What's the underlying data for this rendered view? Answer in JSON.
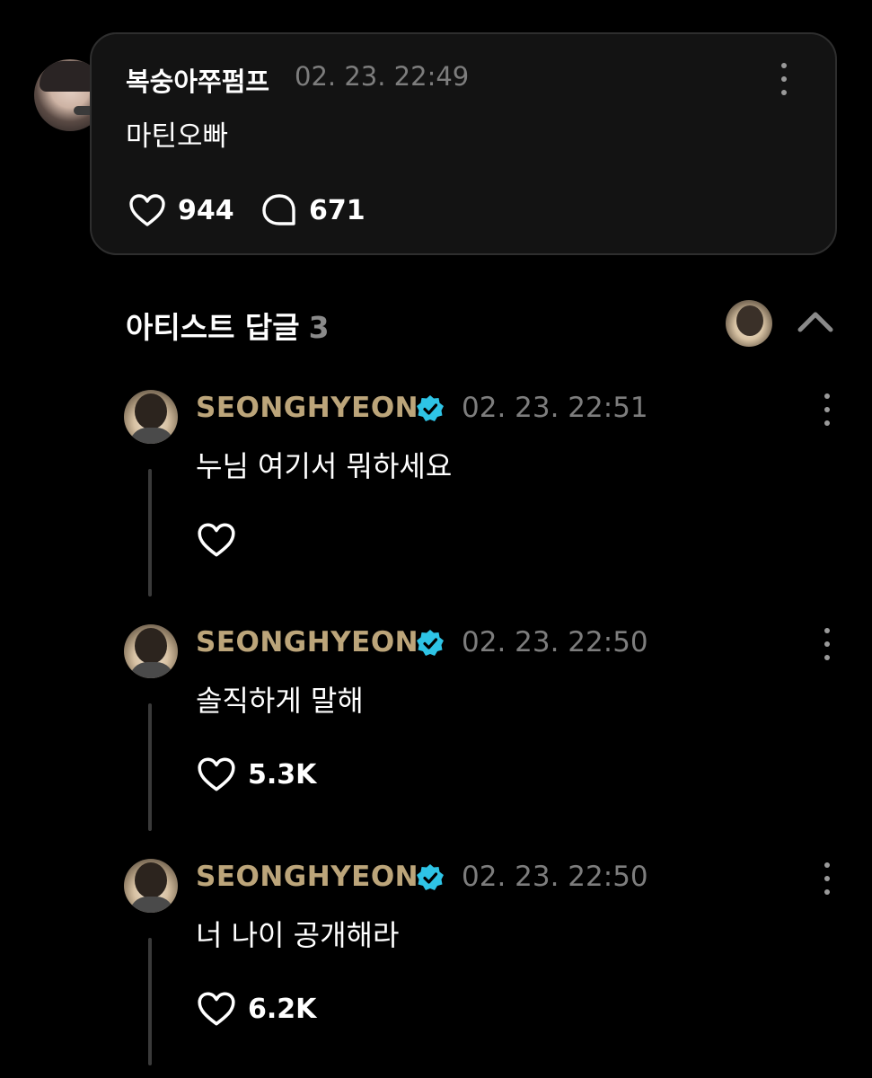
{
  "post": {
    "author": "복숭아쭈펌프",
    "timestamp": "02. 23. 22:49",
    "text": "마틴오빠",
    "likes": "944",
    "comments": "671"
  },
  "artist_replies": {
    "title": "아티스트 답글",
    "count": "3"
  },
  "replies": [
    {
      "author": "SEONGHYEON",
      "timestamp": "02. 23. 22:51",
      "text": "누님 여기서 뭐하세요",
      "likes": ""
    },
    {
      "author": "SEONGHYEON",
      "timestamp": "02. 23. 22:50",
      "text": "솔직하게 말해",
      "likes": "5.3K"
    },
    {
      "author": "SEONGHYEON",
      "timestamp": "02. 23. 22:50",
      "text": "너 나이 공개해라",
      "likes": "6.2K"
    }
  ],
  "icons": {
    "like": "heart-outline-icon",
    "comment": "speech-bubble-icon",
    "more": "kebab-menu-icon",
    "verified": "verified-badge-icon",
    "collapse": "chevron-up-icon"
  },
  "colors": {
    "background": "#000000",
    "card": "#131313",
    "artist_name": "#bca57a",
    "verified": "#2ec4e6",
    "muted": "#7d7d7d"
  }
}
